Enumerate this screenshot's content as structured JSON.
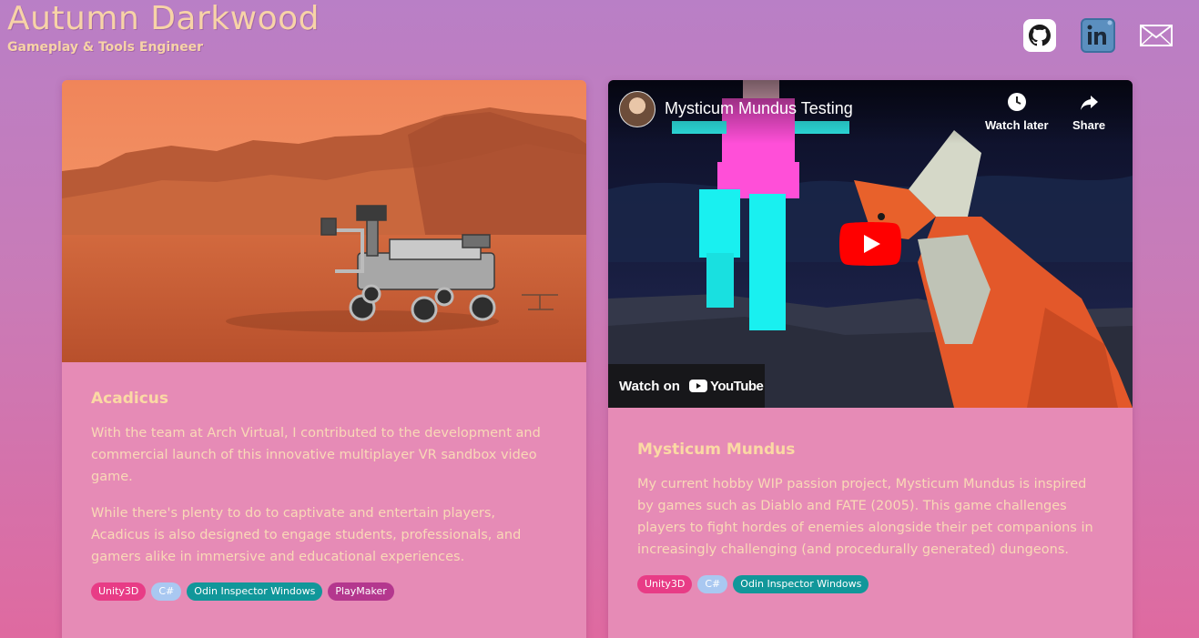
{
  "header": {
    "name": "Autumn Darkwood",
    "subtitle": "Gameplay & Tools Engineer"
  },
  "social": [
    {
      "icon": "github-icon",
      "label": "GitHub"
    },
    {
      "icon": "linkedin-icon",
      "label": "LinkedIn"
    },
    {
      "icon": "mail-icon",
      "label": "Email"
    }
  ],
  "projects": [
    {
      "title": "Acadicus",
      "paragraphs": [
        "With the team at Arch Virtual, I contributed to the development and commercial launch of this innovative multiplayer VR sandbox video game.",
        "While there's plenty to do to captivate and entertain players, Acadicus is also designed to engage students, professionals, and gamers alike in immersive and educational experiences."
      ],
      "tags": [
        "Unity3D",
        "C#",
        "Odin Inspector Windows",
        "PlayMaker"
      ]
    },
    {
      "title": "Mysticum Mundus",
      "video": {
        "title": "Mysticum Mundus Testing",
        "watch_later": "Watch later",
        "share": "Share",
        "watch_on": "Watch on",
        "youtube": "YouTube"
      },
      "paragraphs": [
        "My current hobby WIP passion project, Mysticum Mundus is inspired by games such as Diablo and FATE (2005). This game challenges players to fight hordes of enemies alongside their pet companions in increasingly challenging (and procedurally generated) dungeons."
      ],
      "tags": [
        "Unity3D",
        "C#",
        "Odin Inspector Windows"
      ]
    }
  ],
  "colors": {
    "accent_text": "#f7d3a7",
    "tag_unity": "#e83c86",
    "tag_csharp": "#a9c8f1",
    "tag_odin": "#11979a",
    "tag_playmaker": "#b4378e",
    "youtube_red": "#ff0000"
  }
}
